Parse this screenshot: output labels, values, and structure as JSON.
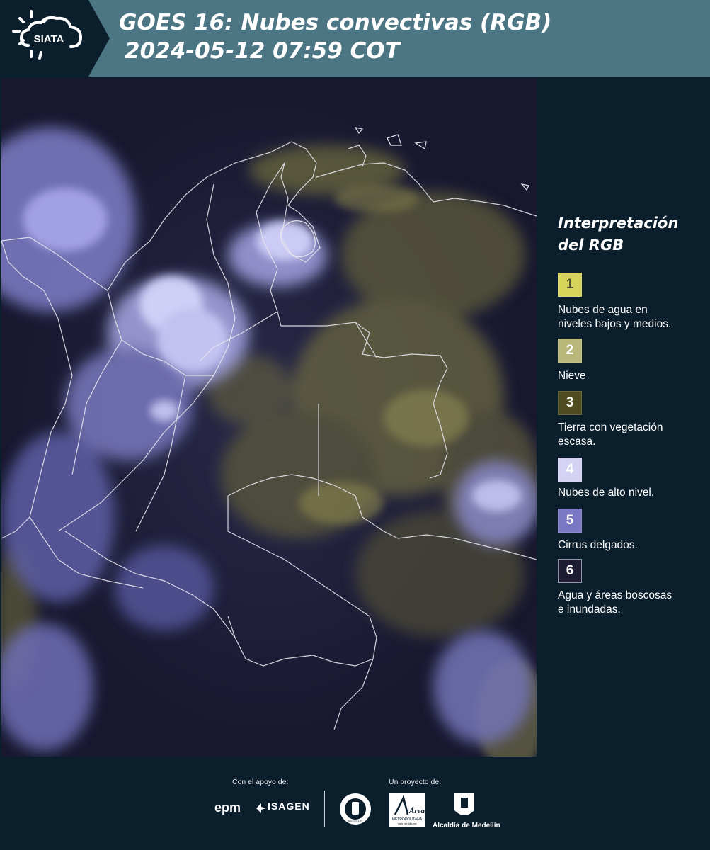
{
  "header": {
    "logo_text": "SIATA",
    "title_line1": "GOES 16: Nubes convectivas (RGB)",
    "title_line2": "2024-05-12 07:59 COT",
    "background_color": "#4d7685"
  },
  "legend": {
    "title_line1": "Interpretación",
    "title_line2": "del RGB",
    "items": [
      {
        "number": "1",
        "label_line1": "Nubes de agua en",
        "label_line2": "niveles bajos y medios.",
        "color": "#d8d35a"
      },
      {
        "number": "2",
        "label_line1": "Nieve",
        "label_line2": "",
        "color": "#b9b77a"
      },
      {
        "number": "3",
        "label_line1": "Tierra con vegetación",
        "label_line2": "escasa.",
        "color": "#4f4c1f"
      },
      {
        "number": "4",
        "label_line1": "Nubes de alto nivel.",
        "label_line2": "",
        "color": "#d4d3f3"
      },
      {
        "number": "5",
        "label_line1": "Cirrus delgados.",
        "label_line2": "",
        "color": "#7a78c4"
      },
      {
        "number": "6",
        "label_line1": "Agua y áreas boscosas",
        "label_line2": "e inundadas.",
        "color": "#1d1c33"
      }
    ]
  },
  "footer": {
    "support_label": "Con el apoyo de:",
    "project_label": "Un proyecto de:",
    "sponsors": [
      "epm",
      "ISAGEN"
    ],
    "area_logo_word": "Área",
    "area_logo_sub1": "METROPOLITANA",
    "area_logo_sub2": "Valle de Aburrá",
    "seal_text": "MEDELLÍN",
    "alcaldia_label": "Alcaldía de Medellín"
  },
  "map": {
    "description_colors": {
      "background": "#1c1b3a",
      "high_clouds": "#c9c8f2",
      "low_clouds": "#bdb86a",
      "borders": "#e6e6ee"
    }
  }
}
